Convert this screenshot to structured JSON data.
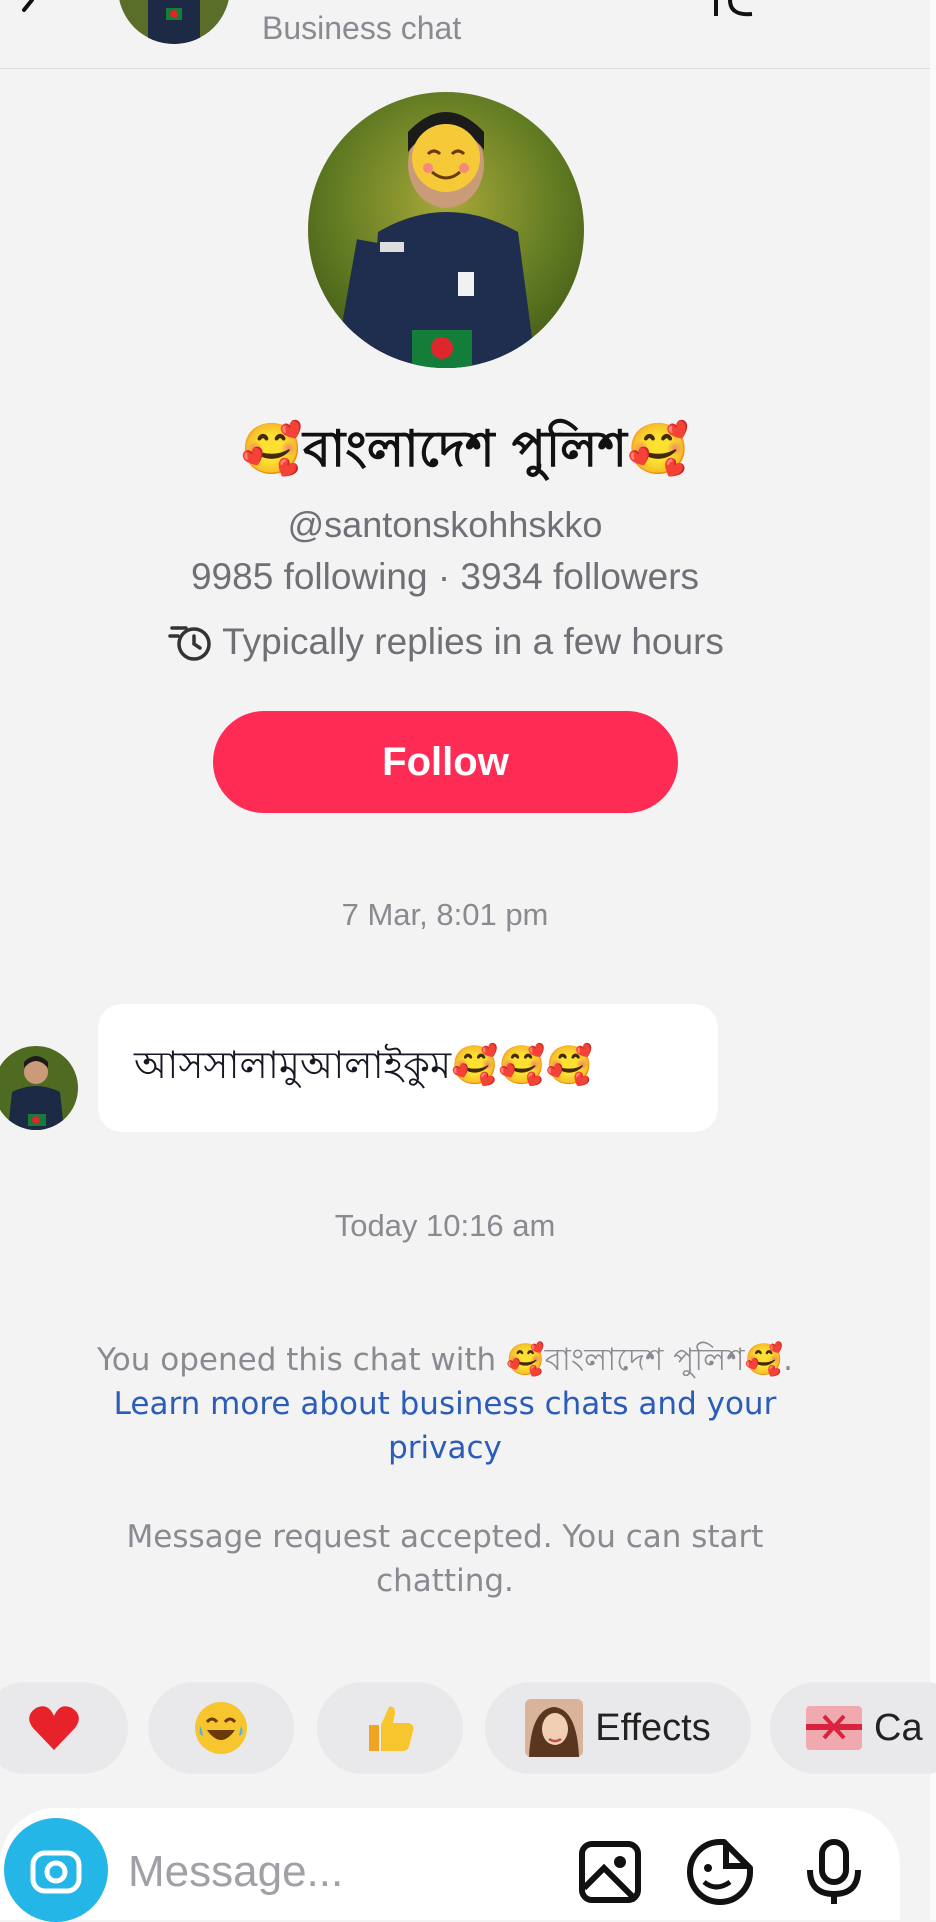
{
  "header": {
    "subtitle": "Business chat"
  },
  "profile": {
    "name": "🥰বাংলাদেশ পুলিশ🥰",
    "username": "@santonskohhskko",
    "stats": "9985 following · 3934 followers",
    "reply_time": "Typically replies in a few hours",
    "follow_label": "Follow"
  },
  "messages": [
    {
      "timestamp": "7 Mar, 8:01 pm",
      "text": "আসসালামুআলাইকুম🥰🥰🥰"
    }
  ],
  "second_timestamp": "Today 10:16 am",
  "notice": {
    "prefix": "You opened this chat with 🥰বাংলাদেশ পুলিশ🥰. ",
    "link": "Learn more about business chats and your privacy"
  },
  "accepted_notice": "Message request accepted. You can start chatting.",
  "quick_reactions": [
    {
      "icon": "heart-icon"
    },
    {
      "icon": "laughing-face-icon"
    },
    {
      "icon": "thumbs-up-icon"
    },
    {
      "icon": "effects-avatar-icon",
      "label": "Effects"
    },
    {
      "icon": "gift-card-icon",
      "label": "Ca"
    }
  ],
  "composer": {
    "placeholder": "Message..."
  },
  "colors": {
    "follow_button": "#fe2c55",
    "camera_button": "#25b6e8",
    "link": "#2b5db8"
  }
}
